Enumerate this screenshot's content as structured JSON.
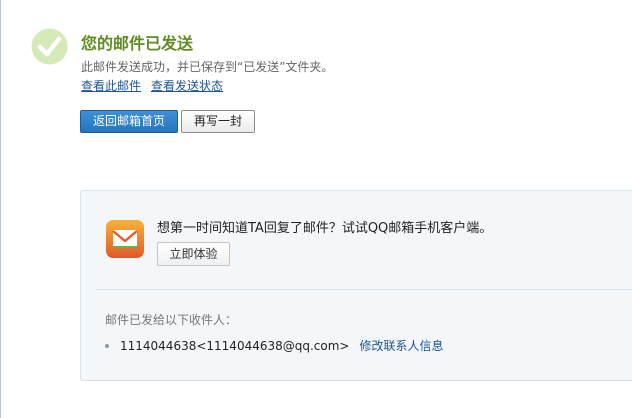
{
  "header": {
    "title": "您的邮件已发送",
    "subtitle": "此邮件发送成功，并已保存到“已发送”文件夹。",
    "link_view_mail": "查看此邮件",
    "link_view_status": "查看发送状态"
  },
  "actions": {
    "back_label": "返回邮箱首页",
    "compose_label": "再写一封"
  },
  "promo": {
    "text": "想第一时间知道TA回复了邮件？试试QQ邮箱手机客户端。",
    "try_label": "立即体验"
  },
  "recipients": {
    "label": "邮件已发给以下收件人：",
    "items": [
      {
        "email": "1114044638<1114044638@qq.com>",
        "edit_label": "修改联系人信息"
      }
    ]
  },
  "colors": {
    "title_green": "#5f8d24",
    "link_blue": "#1e5494",
    "primary_blue": "#2576bd",
    "panel_bg": "#f4f7fa"
  },
  "icons": {
    "success": "check-circle-icon",
    "app": "qq-mail-app-icon"
  }
}
